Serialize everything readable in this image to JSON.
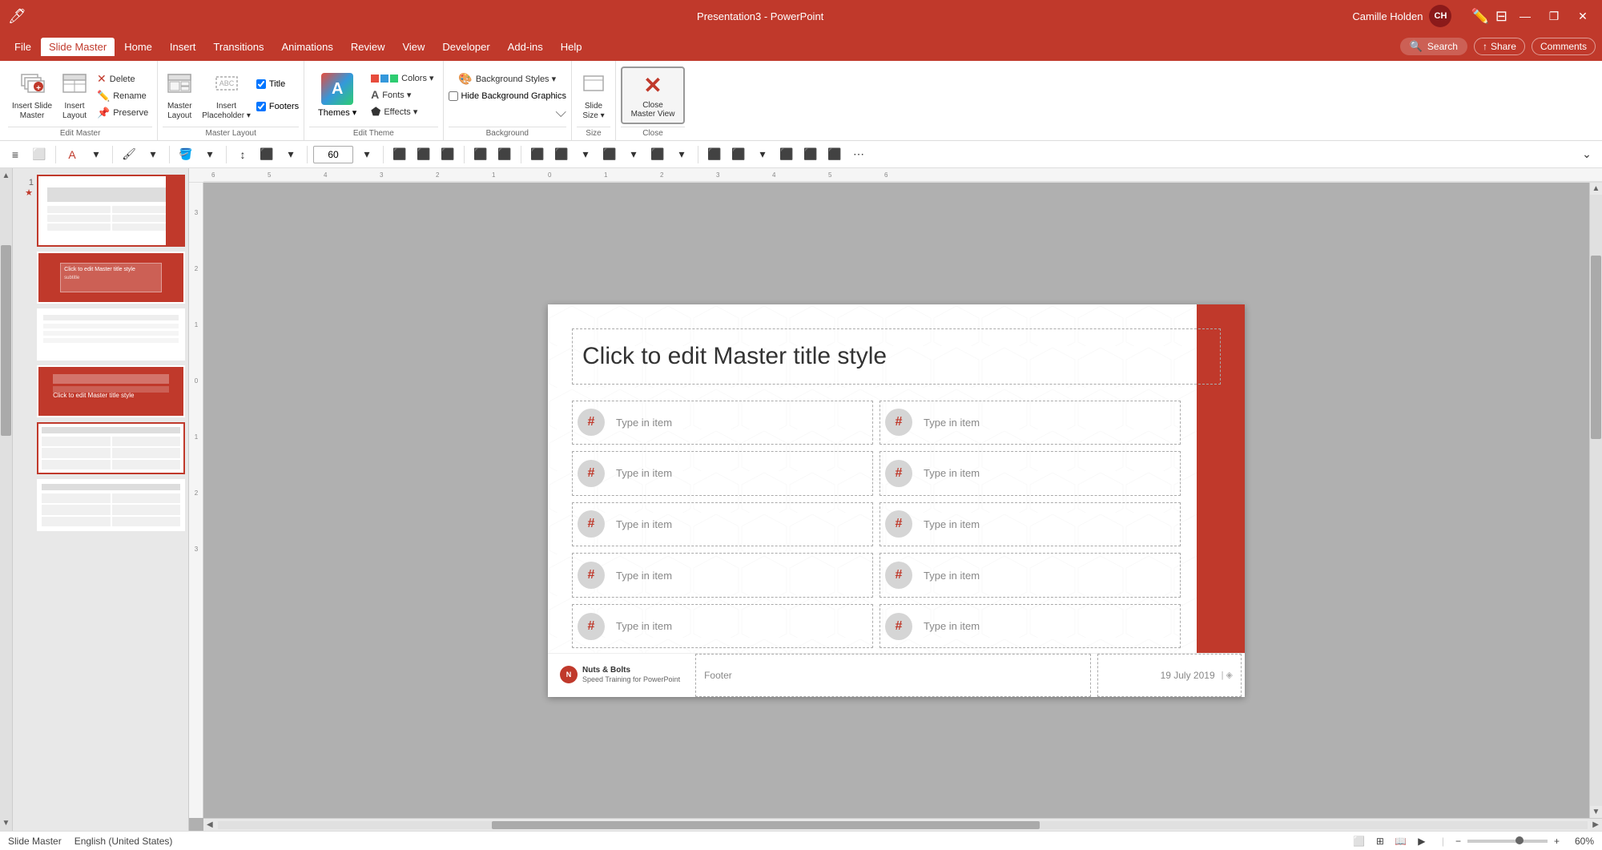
{
  "titlebar": {
    "title": "Presentation3 - PowerPoint",
    "user": "Camille Holden",
    "initials": "CH",
    "minimize": "—",
    "restore": "❐",
    "close": "✕"
  },
  "menubar": {
    "items": [
      "File",
      "Slide Master",
      "Home",
      "Insert",
      "Transitions",
      "Animations",
      "Review",
      "View",
      "Developer",
      "Add-ins",
      "Help"
    ],
    "active": "Slide Master",
    "search_placeholder": "Search",
    "share_label": "Share",
    "comments_label": "Comments"
  },
  "ribbon": {
    "groups": {
      "edit_master": {
        "label": "Edit Master",
        "insert_slide_master": "Insert Slide Master",
        "insert_layout": "Insert Layout",
        "delete": "Delete",
        "rename": "Rename",
        "preserve": "Preserve"
      },
      "master_layout": {
        "label": "Master Layout",
        "master_layout": "Master Layout",
        "insert_placeholder": "Insert Placeholder",
        "title_checked": true,
        "footers_checked": true
      },
      "edit_theme": {
        "label": "Edit Theme",
        "themes": "Themes",
        "colors": "Colors",
        "fonts": "Fonts",
        "effects": "Effects"
      },
      "background": {
        "label": "Background",
        "background_styles": "Background Styles",
        "hide_background_graphics": "Hide Background Graphics"
      },
      "size": {
        "label": "Size",
        "slide_size": "Slide Size"
      },
      "close": {
        "label": "Close",
        "close_master_view": "Close Master View"
      }
    }
  },
  "toolbar": {
    "font_size": "60",
    "zoom_label": "60"
  },
  "slides": {
    "items": [
      {
        "num": "1",
        "star": "★",
        "type": "master"
      },
      {
        "num": "",
        "star": "",
        "type": "layout-red"
      },
      {
        "num": "",
        "star": "",
        "type": "layout-white"
      },
      {
        "num": "",
        "star": "",
        "type": "layout-red2"
      },
      {
        "num": "",
        "star": "",
        "type": "layout-table"
      },
      {
        "num": "",
        "star": "",
        "type": "layout-table2"
      }
    ]
  },
  "slide": {
    "title": "Click to edit Master title style",
    "items": [
      "Type in item",
      "Type in item",
      "Type in item",
      "Type in item",
      "Type in item",
      "Type in item",
      "Type in item",
      "Type in item",
      "Type in item",
      "Type in item"
    ],
    "footer_logo_name": "Nuts & Bolts",
    "footer_logo_sub": "Speed Training for PowerPoint",
    "footer_text": "Footer",
    "footer_date": "19 July 2019"
  },
  "statusbar": {
    "view": "Slide Master",
    "language": "English (United States)",
    "zoom": "60%",
    "zoom_value": 60
  }
}
